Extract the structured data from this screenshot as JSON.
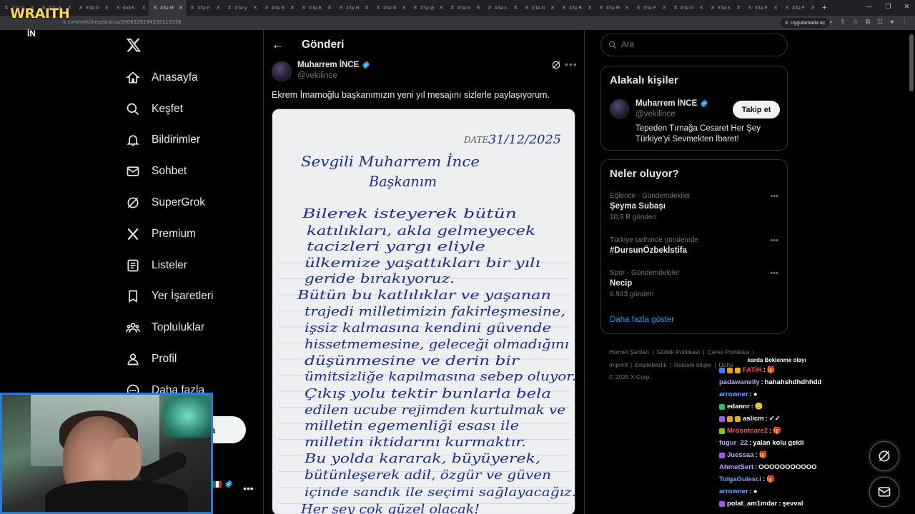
{
  "browser": {
    "tabs": [
      "X'te O",
      "X'te P",
      "X'te D",
      "KickS",
      "X'te M",
      "X'te E",
      "X'te y",
      "X'te B",
      "X'te B",
      "X'te H",
      "X'te N",
      "X'te @",
      "X'te b",
      "X'te k",
      "X'te O",
      "X'te R",
      "X'te M",
      "X'te P",
      "X'te D",
      "X'te S",
      "X'te P",
      "X'te P"
    ],
    "url": "x.com/vekilince/status/2006329194335113336",
    "translate_label": "Uygulamada aç",
    "new_tab": "+"
  },
  "stream_overlay": {
    "logo_text": "WRAITH",
    "logo_sub": "İN"
  },
  "nav": {
    "items": [
      {
        "label": "Anasayfa",
        "icon": "home-icon"
      },
      {
        "label": "Keşfet",
        "icon": "search-icon"
      },
      {
        "label": "Bildirimler",
        "icon": "bell-icon"
      },
      {
        "label": "Sohbet",
        "icon": "mail-icon"
      },
      {
        "label": "SuperGrok",
        "icon": "grok-icon"
      },
      {
        "label": "Premium",
        "icon": "x-icon"
      },
      {
        "label": "Listeler",
        "icon": "list-icon"
      },
      {
        "label": "Yer İşaretleri",
        "icon": "bookmark-icon"
      },
      {
        "label": "Topluluklar",
        "icon": "communities-icon"
      },
      {
        "label": "Profil",
        "icon": "person-icon"
      },
      {
        "label": "Daha fazla",
        "icon": "more-circle-icon"
      }
    ],
    "post_button_fragment": "a"
  },
  "post": {
    "header_title": "Gönderi",
    "author_name": "Muharrem İNCE",
    "author_handle": "@vekilince",
    "text": "Ekrem İmamoğlu başkanımızın yeni yıl mesajını sizlerle paylaşıyorum.",
    "letter": {
      "date_label": "DATE",
      "date_value": "31/12/2025",
      "lines": [
        "Sevgili Muharrem İnce",
        "Başkanım",
        "Bilerek isteyerek bütün",
        "katılıkları, akla gelmeyecek",
        "tacizleri yargı eliyle",
        "ülkemize yaşattıkları bir yılı",
        "geride bırakıyoruz.",
        "Bütün bu katlılıklar ve yaşanan",
        "trajedi milletimizin fakirleşmesine,",
        "işsiz kalmasına kendini güvende",
        "hissetmemesine, geleceği olmadığını",
        "düşünmesine ve derin bir",
        "ümitsizliğe kapılmasına sebep oluyor.",
        "Çıkış yolu tektir bunlarla bela",
        "edilen ucube rejimden kurtulmak ve",
        "milletin egemenliği esası ile",
        "milletin iktidarını kurmaktır.",
        "Bu yolda kararak, büyüyerek,",
        "bütünleşerek adil, özgür ve güven",
        "içinde sandık ile seçimi sağlayacağız.",
        "Her şey çok güzel olacak!"
      ]
    }
  },
  "search": {
    "placeholder": "Ara"
  },
  "related": {
    "title": "Alakalı kişiler",
    "name": "Muharrem İNCE",
    "handle": "@vekilince",
    "follow_label": "Takip et",
    "bio": "Tepeden Tırnağa Cesaret Her Şey Türkiye'yi Sevmekten İbaret!"
  },
  "trends": {
    "title": "Neler oluyor?",
    "items": [
      {
        "category": "Eğlence · Gündemdekiler",
        "topic": "Şeyma Subaşı",
        "count": "10,9 B gönderi"
      },
      {
        "category": "Türkiye tarihinde gündemde",
        "topic": "#DursunÖzbekİstifa",
        "count": ""
      },
      {
        "category": "Spor · Gündemdekiler",
        "topic": "Necip",
        "count": "6.943 gönderi"
      }
    ],
    "show_more": "Daha fazla göster"
  },
  "footer": {
    "links": [
      "Hizmet Şartları",
      "|",
      "Gizlilik Politikası",
      "|",
      "Çerez Politikası",
      "|",
      "Imprint",
      "|",
      "Erişilebilirlik",
      "|",
      "Reklam bilgisi",
      "|",
      "Daha"
    ],
    "copyright": "© 2025 X Corp."
  },
  "chat": {
    "partial_line": "karda Beklenme olayı",
    "messages": [
      {
        "user": "FATİH",
        "msg": "🎁",
        "color": "#ff4d4d",
        "badges": [
          "#3b82f6",
          "#f59e0b",
          "#eab308"
        ]
      },
      {
        "user": "padawanelly",
        "msg": "hahahshdhdhhdd",
        "color": "#b9a6ff",
        "badges": []
      },
      {
        "user": "arrowner",
        "msg": "●",
        "color": "#6aa8ff",
        "badges": []
      },
      {
        "user": "edannr",
        "msg": "🙂",
        "color": "#ffffff",
        "badges": [
          "#22c55e"
        ]
      },
      {
        "user": "aslicm",
        "msg": "✓✓",
        "color": "#ffffff",
        "badges": [
          "#a855f7",
          "#f59e0b",
          "#eab308"
        ]
      },
      {
        "user": "Mrdontcare2",
        "msg": "🎁",
        "color": "#ff4d4d",
        "badges": [
          "#84cc16"
        ]
      },
      {
        "user": "fugur_22",
        "msg": "yalan kolu geldi",
        "color": "#b9a6ff",
        "badges": []
      },
      {
        "user": "Juessaa",
        "msg": "🎁",
        "color": "#b9a6ff",
        "badges": [
          "#a855f7"
        ]
      },
      {
        "user": "AhmetSert",
        "msg": "OOOOOOOOOOO",
        "color": "#b9a6ff",
        "badges": []
      },
      {
        "user": "TolgaGulesci",
        "msg": "🎁",
        "color": "#6aa8ff",
        "badges": []
      },
      {
        "user": "arrowner",
        "msg": "●",
        "color": "#6aa8ff",
        "badges": []
      },
      {
        "user": "polat_am1mdar",
        "msg": "şevval",
        "color": "#ffffff",
        "badges": [
          "#a855f7"
        ]
      }
    ]
  }
}
